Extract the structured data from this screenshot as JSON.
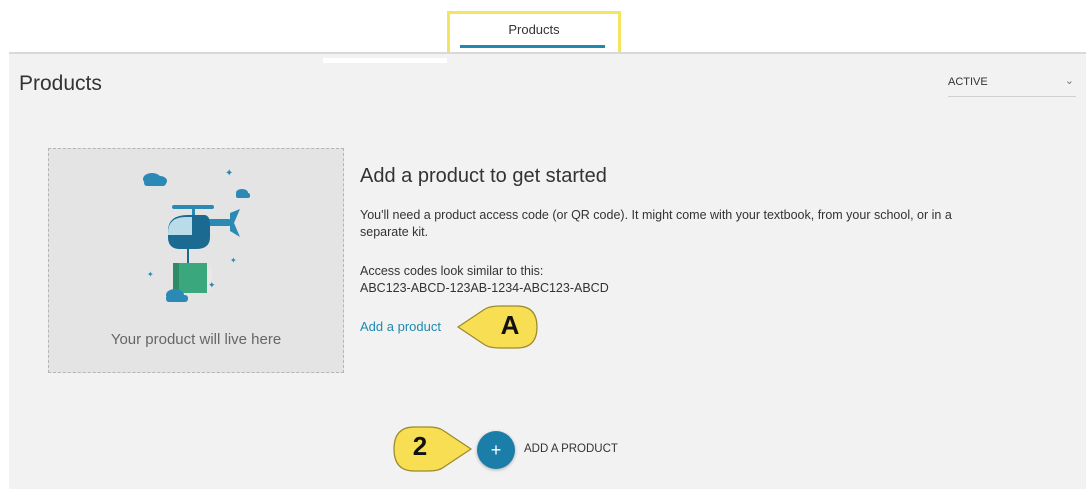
{
  "tabs": [
    {
      "label": "Products",
      "active": true
    }
  ],
  "page": {
    "title": "Products"
  },
  "filter": {
    "selected": "ACTIVE"
  },
  "empty_state": {
    "placeholder_caption": "Your product will live here",
    "heading": "Add a product to get started",
    "description": "You'll need a product access code (or QR code). It might come with your textbook, from your school, or in a separate kit.",
    "codes_label": "Access codes look similar to this:",
    "codes_example": "ABC123-ABCD-123AB-1234-ABC123-ABCD",
    "add_link": "Add a product"
  },
  "add_button": {
    "icon": "+",
    "label": "ADD A PRODUCT"
  },
  "callouts": {
    "a": "A",
    "b": "2"
  },
  "colors": {
    "accent": "#1f8ab0",
    "highlight": "#f5e45e",
    "callout": "#f7de52"
  }
}
